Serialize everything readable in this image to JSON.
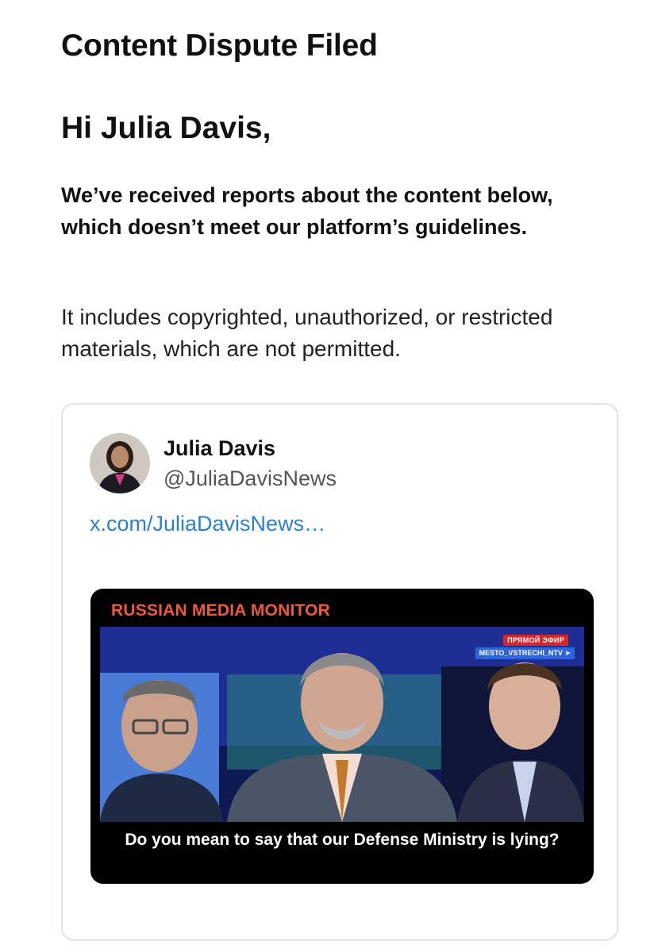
{
  "email": {
    "title": "Content Dispute Filed",
    "greeting": "Hi Julia Davis,",
    "lead": "We’ve received reports about the content below, which doesn’t meet our platform’s guidelines.",
    "body": "It includes copyrighted, unauthorized, or restricted materials, which are not permitted."
  },
  "post": {
    "author_name": "Julia Davis",
    "author_handle": "@JuliaDavisNews",
    "link_text": "x.com/JuliaDavisNews…",
    "media": {
      "brand": "RUSSIAN MEDIA MONITOR",
      "live_badge": "ПРЯМОЙ ЭФИР",
      "channel": "MESTO_VSTRECHI_NTV",
      "caption": "Do you mean to say that our Defense Ministry is lying?"
    }
  },
  "colors": {
    "link": "#2a7fd4",
    "brand_red": "#f05a3b",
    "card_border": "#dfe3e8"
  }
}
